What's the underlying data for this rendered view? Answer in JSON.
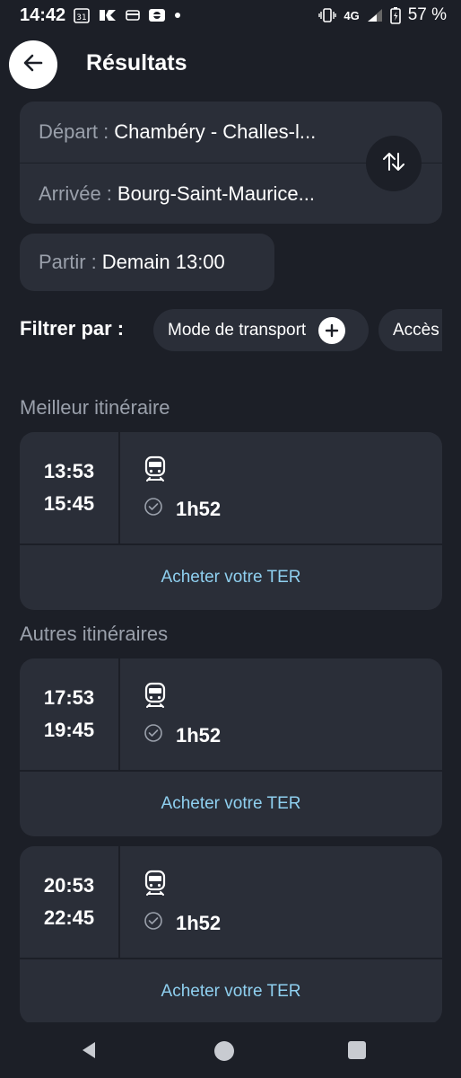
{
  "status_bar": {
    "time": "14:42",
    "calendar_day": "31",
    "network": "4G",
    "battery": "57 %"
  },
  "header": {
    "title": "Résultats"
  },
  "route": {
    "departure_label": "Départ :",
    "departure_value": "Chambéry - Challes-l...",
    "arrival_label": "Arrivée :",
    "arrival_value": "Bourg-Saint-Maurice..."
  },
  "departure_time": {
    "label": "Partir :",
    "value": "Demain 13:00"
  },
  "filters": {
    "label": "Filtrer par :",
    "chips": [
      "Mode de transport",
      "Accès"
    ]
  },
  "best": {
    "title": "Meilleur itinéraire"
  },
  "others": {
    "title": "Autres itinéraires"
  },
  "itineraries": [
    {
      "depart": "13:53",
      "arrive": "15:45",
      "duration": "1h52",
      "buy_label": "Acheter votre TER"
    },
    {
      "depart": "17:53",
      "arrive": "19:45",
      "duration": "1h52",
      "buy_label": "Acheter votre TER"
    },
    {
      "depart": "20:53",
      "arrive": "22:45",
      "duration": "1h52",
      "buy_label": "Acheter votre TER"
    }
  ],
  "icons": {
    "back": "arrow-left-icon",
    "swap": "swap-vertical-icon",
    "add": "plus-icon",
    "train": "train-icon",
    "clock": "clock-icon"
  },
  "colors": {
    "background": "#1c1f27",
    "card": "#2a2e38",
    "muted_text": "#9aa0ab",
    "link": "#8fd0f0"
  }
}
